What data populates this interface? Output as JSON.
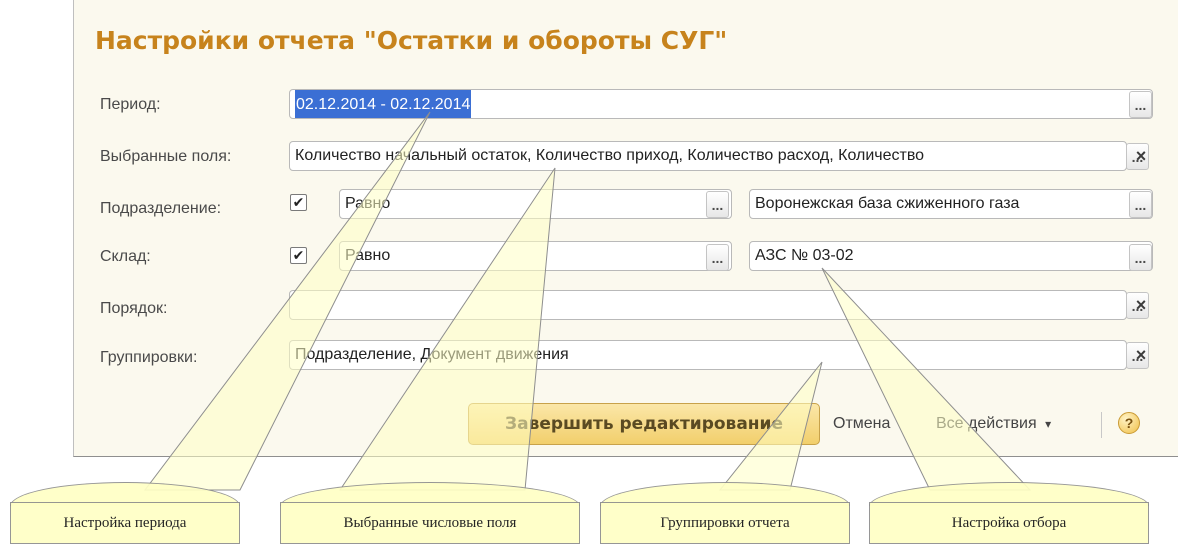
{
  "dialog": {
    "title": "Настройки отчета \"Остатки и обороты СУГ\""
  },
  "form": {
    "period": {
      "label": "Период:",
      "value": "02.12.2014 - 02.12.2014"
    },
    "selected_fields": {
      "label": "Выбранные поля:",
      "value": "Количество начальный остаток, Количество приход, Количество расход, Количество"
    },
    "subdivision": {
      "label": "Подразделение:",
      "checked": true,
      "condition": "Равно",
      "value": "Воронежская база сжиженного газа"
    },
    "warehouse": {
      "label": "Склад:",
      "checked": true,
      "condition": "Равно",
      "value": "АЗС № 03-02"
    },
    "order": {
      "label": "Порядок:",
      "value": ""
    },
    "groupings": {
      "label": "Группировки:",
      "value": "Подразделение, Документ движения"
    }
  },
  "icons": {
    "ellipsis": "...",
    "clear": "×",
    "check": "✔",
    "help": "?",
    "dropdown": "▾"
  },
  "footer": {
    "finish_label": "Завершить редактирование",
    "cancel_label": "Отмена",
    "all_actions_label": "Все действия",
    "dropdown_glyph": "▾"
  },
  "callouts": [
    {
      "label": "Настройка периода"
    },
    {
      "label": "Выбранные числовые поля"
    },
    {
      "label": "Группировки отчета"
    },
    {
      "label": "Настройка отбора"
    }
  ]
}
